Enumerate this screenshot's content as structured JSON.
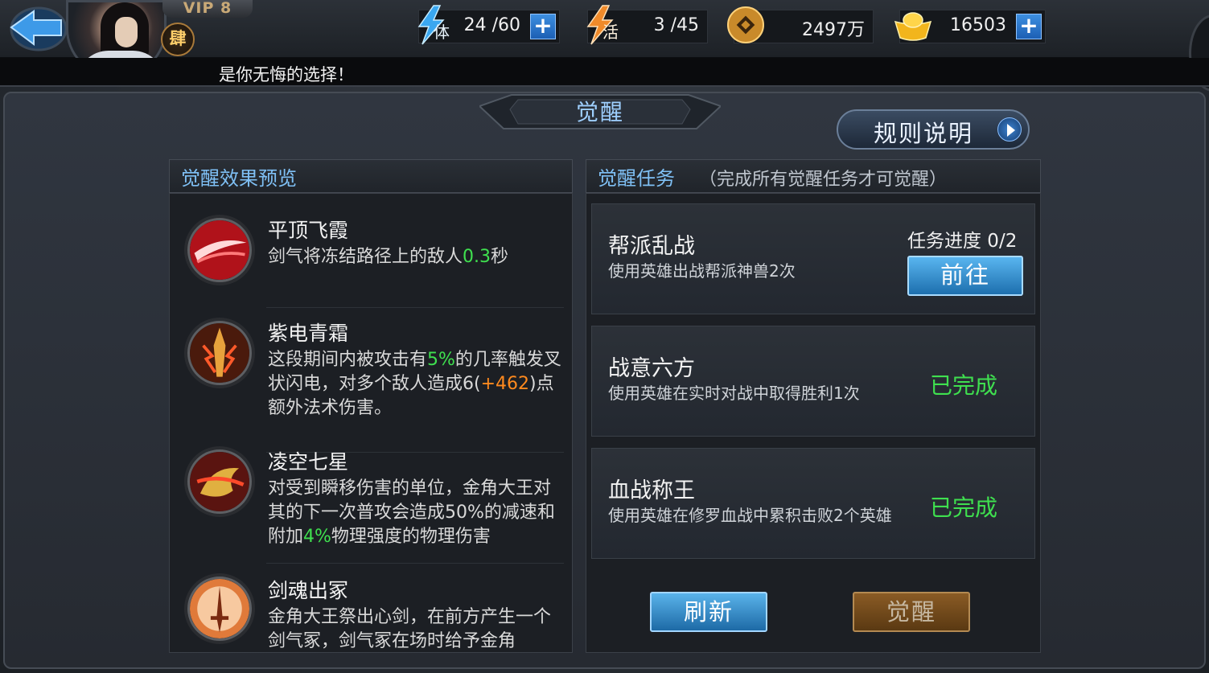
{
  "header": {
    "vip_label": "VIP 8",
    "rank_badge": "肆",
    "marquee": "是你无悔的选择！",
    "stamina": {
      "icon_label": "体",
      "value": "24 /60"
    },
    "vitality": {
      "icon_label": "活",
      "value": "3 /45"
    },
    "coins": {
      "value": "2497万"
    },
    "gold": {
      "value": "16503"
    },
    "plus_label": "+"
  },
  "page": {
    "title": "觉醒",
    "rules_button": "规则说明"
  },
  "preview": {
    "heading": "觉醒效果预览",
    "skills": [
      {
        "name": "平顶飞霞",
        "desc": [
          "剑气将冻结路径上的敌人",
          "0.3",
          "秒"
        ]
      },
      {
        "name": "紫电青霜",
        "desc": [
          "这段期间内被攻击有",
          "5%",
          "的几率触发叉状闪电，对多个敌人造成6(",
          "+462",
          ")点额外法术伤害。"
        ]
      },
      {
        "name": "凌空七星",
        "desc": [
          "对受到瞬移伤害的单位，金角大王对其的下一次普攻会造成50%的减速和附加",
          "4%",
          "物理强度的物理伤害"
        ]
      },
      {
        "name": "剑魂出冢",
        "desc": [
          "金角大王祭出心剑，在前方产生一个剑气冢，剑气冢在场时给予金角"
        ]
      }
    ]
  },
  "tasks": {
    "heading": "觉醒任务",
    "note": "（完成所有觉醒任务才可觉醒）",
    "items": [
      {
        "name": "帮派乱战",
        "desc": "使用英雄出战帮派神兽2次",
        "progress": "任务进度 0/2",
        "action": "前往"
      },
      {
        "name": "战意六方",
        "desc": "使用英雄在实时对战中取得胜利1次",
        "status": "已完成"
      },
      {
        "name": "血战称王",
        "desc": "使用英雄在修罗血战中累积击败2个英雄",
        "status": "已完成"
      }
    ],
    "refresh_button": "刷新",
    "awaken_button": "觉醒"
  },
  "colors": {
    "highlight_green": "#3fe04f",
    "highlight_orange": "#ff8a1e",
    "title_blue": "#9fd0ff"
  }
}
